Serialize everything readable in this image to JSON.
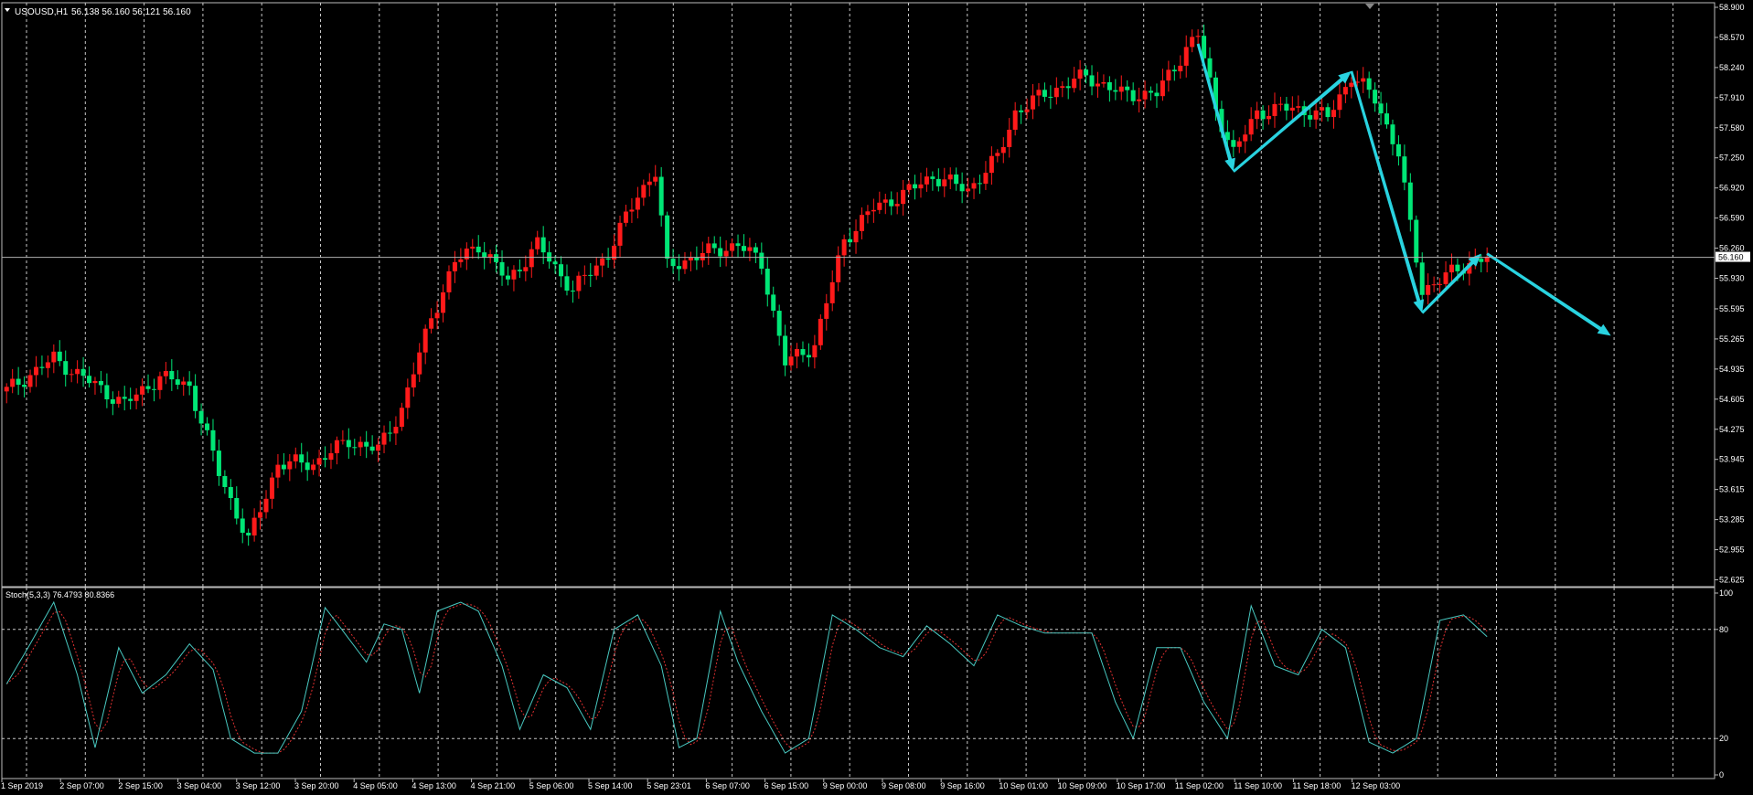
{
  "window": {
    "symbol_label": "USOUSD,H1",
    "ohlc_label": "56.138 56.160 56.121 56.160",
    "indicator_label": "Stoch(5,3,3) 76.4793 80.8366"
  },
  "colors": {
    "background": "#000000",
    "up_candle": "#ff1a1a",
    "down_candle": "#00e676",
    "grid": "#c8c8c8",
    "arrow": "#29d3e0",
    "stoch_main": "#48c8c0",
    "stoch_signal": "#e03030"
  },
  "price_axis": {
    "ticks": [
      "58.900",
      "58.570",
      "58.240",
      "57.910",
      "57.580",
      "57.250",
      "56.920",
      "56.590",
      "56.260",
      "55.930",
      "55.595",
      "55.265",
      "54.935",
      "54.605",
      "54.275",
      "53.945",
      "53.615",
      "53.285",
      "52.955",
      "52.625"
    ],
    "current_price": "56.160",
    "range": [
      52.55,
      58.95
    ]
  },
  "stoch_axis": {
    "ticks": [
      "100",
      "80",
      "20",
      "0"
    ],
    "levels": [
      20,
      80
    ]
  },
  "time_axis": {
    "labels": [
      "1 Sep 2019",
      "2 Sep 07:00",
      "2 Sep 15:00",
      "3 Sep 04:00",
      "3 Sep 12:00",
      "3 Sep 20:00",
      "4 Sep 05:00",
      "4 Sep 13:00",
      "4 Sep 21:00",
      "5 Sep 06:00",
      "5 Sep 14:00",
      "5 Sep 23:01",
      "6 Sep 07:00",
      "6 Sep 15:00",
      "9 Sep 00:00",
      "9 Sep 08:00",
      "9 Sep 16:00",
      "10 Sep 01:00",
      "10 Sep 09:00",
      "10 Sep 17:00",
      "11 Sep 02:00",
      "11 Sep 10:00",
      "11 Sep 18:00",
      "12 Sep 03:00"
    ]
  },
  "chart_data": {
    "type": "candlestick",
    "symbol": "USOUSD",
    "timeframe": "H1",
    "x_start": "1 Sep 2019",
    "price_range": [
      52.625,
      58.9
    ],
    "close_path": [
      {
        "bar": 0,
        "price": 54.7
      },
      {
        "bar": 8,
        "price": 55.05
      },
      {
        "bar": 14,
        "price": 54.8
      },
      {
        "bar": 20,
        "price": 54.55
      },
      {
        "bar": 26,
        "price": 54.85
      },
      {
        "bar": 31,
        "price": 54.75
      },
      {
        "bar": 36,
        "price": 53.8
      },
      {
        "bar": 41,
        "price": 53.05
      },
      {
        "bar": 46,
        "price": 53.9
      },
      {
        "bar": 52,
        "price": 53.9
      },
      {
        "bar": 58,
        "price": 54.15
      },
      {
        "bar": 63,
        "price": 54.05
      },
      {
        "bar": 67,
        "price": 54.5
      },
      {
        "bar": 72,
        "price": 55.5
      },
      {
        "bar": 76,
        "price": 56.1
      },
      {
        "bar": 80,
        "price": 56.3
      },
      {
        "bar": 85,
        "price": 55.9
      },
      {
        "bar": 90,
        "price": 56.3
      },
      {
        "bar": 96,
        "price": 55.8
      },
      {
        "bar": 102,
        "price": 56.2
      },
      {
        "bar": 107,
        "price": 56.85
      },
      {
        "bar": 110,
        "price": 57.1
      },
      {
        "bar": 112,
        "price": 56.05
      },
      {
        "bar": 118,
        "price": 56.2
      },
      {
        "bar": 124,
        "price": 56.3
      },
      {
        "bar": 128,
        "price": 56.1
      },
      {
        "bar": 132,
        "price": 55.0
      },
      {
        "bar": 137,
        "price": 55.2
      },
      {
        "bar": 142,
        "price": 56.35
      },
      {
        "bar": 147,
        "price": 56.7
      },
      {
        "bar": 152,
        "price": 56.85
      },
      {
        "bar": 157,
        "price": 57.05
      },
      {
        "bar": 163,
        "price": 56.9
      },
      {
        "bar": 168,
        "price": 57.25
      },
      {
        "bar": 171,
        "price": 57.75
      },
      {
        "bar": 176,
        "price": 57.95
      },
      {
        "bar": 183,
        "price": 58.15
      },
      {
        "bar": 189,
        "price": 57.95
      },
      {
        "bar": 195,
        "price": 57.95
      },
      {
        "bar": 200,
        "price": 58.45
      },
      {
        "bar": 202,
        "price": 58.6
      },
      {
        "bar": 205,
        "price": 57.8
      },
      {
        "bar": 208,
        "price": 57.3
      },
      {
        "bar": 212,
        "price": 57.75
      },
      {
        "bar": 218,
        "price": 57.8
      },
      {
        "bar": 224,
        "price": 57.7
      },
      {
        "bar": 228,
        "price": 58.15
      },
      {
        "bar": 232,
        "price": 57.9
      },
      {
        "bar": 236,
        "price": 57.3
      },
      {
        "bar": 238,
        "price": 56.5
      },
      {
        "bar": 240,
        "price": 55.8
      },
      {
        "bar": 244,
        "price": 55.95
      },
      {
        "bar": 248,
        "price": 56.1
      },
      {
        "bar": 251,
        "price": 56.16
      }
    ],
    "stoch_main_path": [
      {
        "bar": 0,
        "v": 50
      },
      {
        "bar": 4,
        "v": 72
      },
      {
        "bar": 8,
        "v": 95
      },
      {
        "bar": 12,
        "v": 55
      },
      {
        "bar": 15,
        "v": 15
      },
      {
        "bar": 19,
        "v": 70
      },
      {
        "bar": 23,
        "v": 45
      },
      {
        "bar": 27,
        "v": 55
      },
      {
        "bar": 31,
        "v": 72
      },
      {
        "bar": 35,
        "v": 58
      },
      {
        "bar": 38,
        "v": 20
      },
      {
        "bar": 42,
        "v": 12
      },
      {
        "bar": 46,
        "v": 12
      },
      {
        "bar": 50,
        "v": 35
      },
      {
        "bar": 54,
        "v": 92
      },
      {
        "bar": 58,
        "v": 75
      },
      {
        "bar": 61,
        "v": 62
      },
      {
        "bar": 64,
        "v": 83
      },
      {
        "bar": 67,
        "v": 80
      },
      {
        "bar": 70,
        "v": 45
      },
      {
        "bar": 73,
        "v": 90
      },
      {
        "bar": 77,
        "v": 95
      },
      {
        "bar": 80,
        "v": 90
      },
      {
        "bar": 84,
        "v": 60
      },
      {
        "bar": 87,
        "v": 25
      },
      {
        "bar": 91,
        "v": 55
      },
      {
        "bar": 95,
        "v": 48
      },
      {
        "bar": 99,
        "v": 25
      },
      {
        "bar": 103,
        "v": 80
      },
      {
        "bar": 107,
        "v": 88
      },
      {
        "bar": 111,
        "v": 60
      },
      {
        "bar": 114,
        "v": 15
      },
      {
        "bar": 117,
        "v": 20
      },
      {
        "bar": 121,
        "v": 90
      },
      {
        "bar": 124,
        "v": 62
      },
      {
        "bar": 128,
        "v": 35
      },
      {
        "bar": 132,
        "v": 12
      },
      {
        "bar": 136,
        "v": 20
      },
      {
        "bar": 140,
        "v": 88
      },
      {
        "bar": 144,
        "v": 80
      },
      {
        "bar": 148,
        "v": 70
      },
      {
        "bar": 152,
        "v": 65
      },
      {
        "bar": 156,
        "v": 82
      },
      {
        "bar": 160,
        "v": 72
      },
      {
        "bar": 164,
        "v": 60
      },
      {
        "bar": 168,
        "v": 88
      },
      {
        "bar": 172,
        "v": 82
      },
      {
        "bar": 176,
        "v": 78
      },
      {
        "bar": 180,
        "v": 78
      },
      {
        "bar": 184,
        "v": 78
      },
      {
        "bar": 188,
        "v": 40
      },
      {
        "bar": 191,
        "v": 20
      },
      {
        "bar": 195,
        "v": 70
      },
      {
        "bar": 199,
        "v": 70
      },
      {
        "bar": 203,
        "v": 40
      },
      {
        "bar": 207,
        "v": 20
      },
      {
        "bar": 211,
        "v": 93
      },
      {
        "bar": 215,
        "v": 60
      },
      {
        "bar": 219,
        "v": 55
      },
      {
        "bar": 223,
        "v": 80
      },
      {
        "bar": 227,
        "v": 70
      },
      {
        "bar": 231,
        "v": 18
      },
      {
        "bar": 235,
        "v": 12
      },
      {
        "bar": 239,
        "v": 20
      },
      {
        "bar": 243,
        "v": 85
      },
      {
        "bar": 247,
        "v": 88
      },
      {
        "bar": 251,
        "v": 76
      }
    ],
    "arrows": [
      {
        "from": [
          202,
          58.5
        ],
        "to": [
          208,
          57.1
        ]
      },
      {
        "from": [
          208,
          57.1
        ],
        "to": [
          228,
          58.2
        ]
      },
      {
        "from": [
          228,
          58.2
        ],
        "to": [
          240,
          55.55
        ]
      },
      {
        "from": [
          240,
          55.55
        ],
        "to": [
          250,
          56.2
        ]
      },
      {
        "from": [
          251,
          56.2
        ],
        "to": [
          272,
          55.3
        ]
      }
    ]
  }
}
